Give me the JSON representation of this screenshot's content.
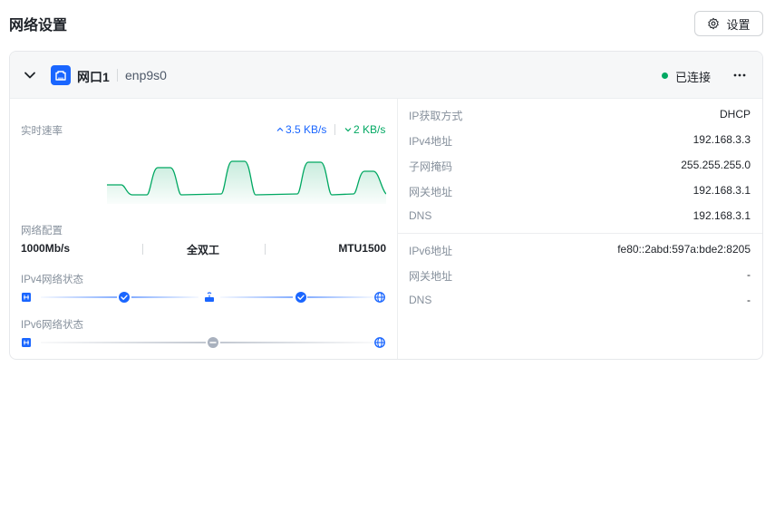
{
  "header": {
    "title": "网络设置",
    "settings_label": "设置",
    "settings_icon": "gear-icon"
  },
  "port": {
    "name": "网口1",
    "interface": "enp9s0",
    "status": "已连接",
    "status_color": "#00a862",
    "accent_color": "#1a66ff"
  },
  "speed": {
    "label": "实时速率",
    "up": "3.5 KB/s",
    "down": "2 KB/s"
  },
  "config": {
    "label": "网络配置",
    "speed": "1000Mb/s",
    "duplex": "全双工",
    "mtu": "MTU1500"
  },
  "ipv4_status": {
    "label": "IPv4网络状态",
    "nodes": [
      "lan-icon",
      "check-icon",
      "router-icon",
      "check-icon",
      "globe-icon"
    ]
  },
  "ipv6_status": {
    "label": "IPv6网络状态",
    "nodes": [
      "lan-icon",
      "minus-icon",
      "globe-icon"
    ]
  },
  "ipv4": {
    "rows": [
      {
        "key": "IP获取方式",
        "value": "DHCP"
      },
      {
        "key": "IPv4地址",
        "value": "192.168.3.3"
      },
      {
        "key": "子网掩码",
        "value": "255.255.255.0"
      },
      {
        "key": "网关地址",
        "value": "192.168.3.1"
      },
      {
        "key": "DNS",
        "value": "192.168.3.1"
      }
    ]
  },
  "ipv6": {
    "rows": [
      {
        "key": "IPv6地址",
        "value": "fe80::2abd:597a:bde2:8205"
      },
      {
        "key": "网关地址",
        "value": "-"
      },
      {
        "key": "DNS",
        "value": "-"
      }
    ]
  }
}
